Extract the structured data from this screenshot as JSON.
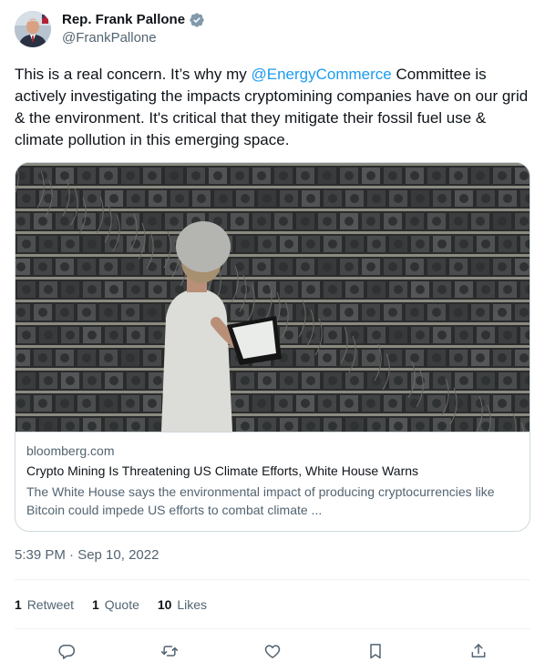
{
  "author": {
    "name": "Rep. Frank Pallone",
    "handle": "@FrankPallone",
    "verified_color": "#829aab"
  },
  "tweet": {
    "text_before": "This is a real concern. It’s why my ",
    "mention": "@EnergyCommerce",
    "text_after": " Committee is actively investigating the impacts cryptomining companies have on our grid & the environment. It's critical that they mitigate their fossil fuel use & climate pollution in this emerging space.",
    "mention_color": "#1d9bf0"
  },
  "card": {
    "domain": "bloomberg.com",
    "title": "Crypto Mining Is Threatening US Climate Efforts, White House Warns",
    "description": "The White House says the environmental impact of producing cryptocurrencies like Bitcoin could impede US efforts to combat climate ..."
  },
  "timestamp": "5:39 PM · Sep 10, 2022",
  "stats": {
    "retweets_count": "1",
    "retweets_label": "Retweet",
    "quotes_count": "1",
    "quotes_label": "Quote",
    "likes_count": "10",
    "likes_label": "Likes"
  },
  "actions": [
    "reply-icon",
    "retweet-icon",
    "like-icon",
    "bookmark-icon",
    "share-icon"
  ]
}
